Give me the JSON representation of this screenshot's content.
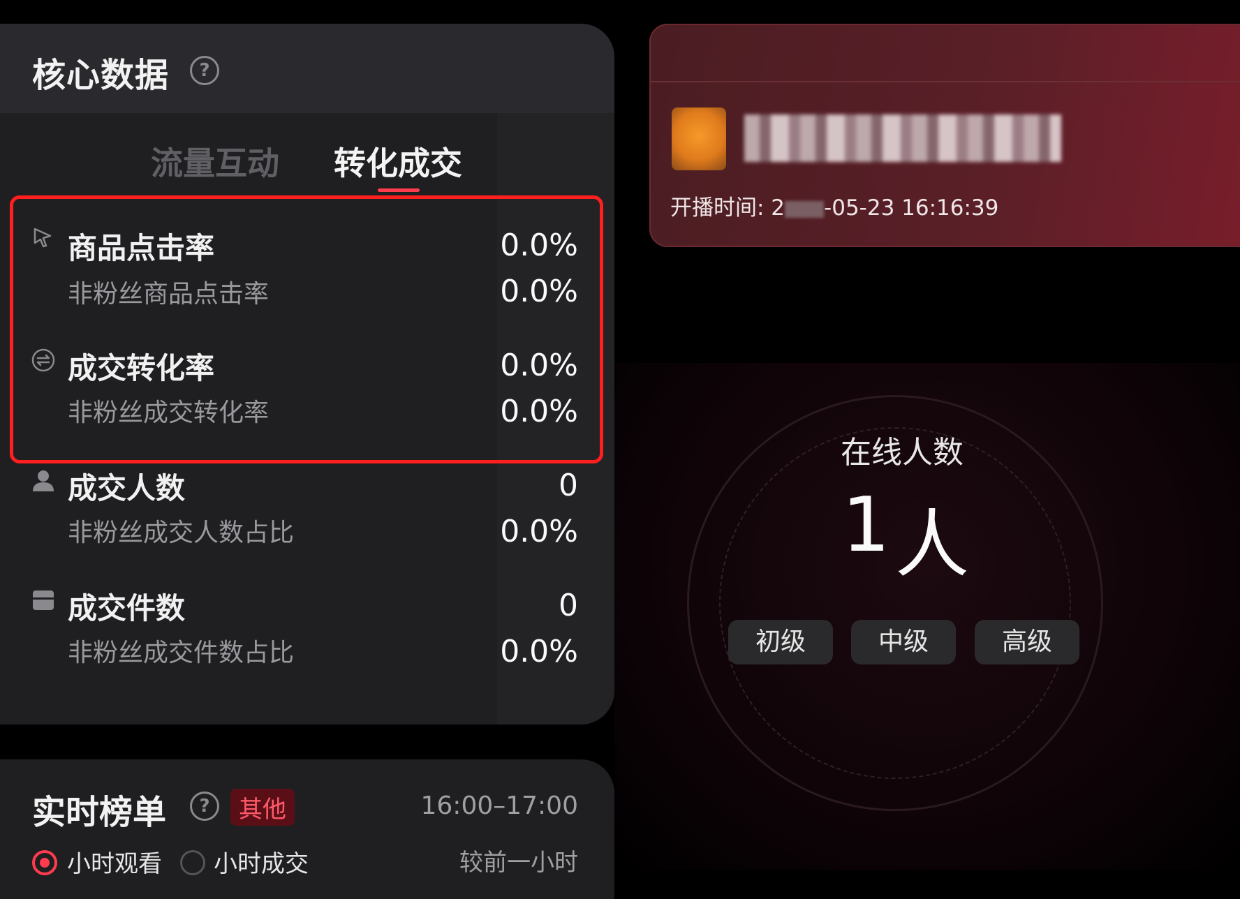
{
  "core": {
    "title": "核心数据",
    "help": "?",
    "tabs": [
      "流量互动",
      "转化成交"
    ],
    "metrics": [
      {
        "name": "商品点击率",
        "value": "0.0%",
        "sub": "非粉丝商品点击率",
        "sub_value": "0.0%",
        "icon": "cursor-click-icon"
      },
      {
        "name": "成交转化率",
        "value": "0.0%",
        "sub": "非粉丝成交转化率",
        "sub_value": "0.0%",
        "icon": "exchange-icon"
      },
      {
        "name": "成交人数",
        "value": "0",
        "sub": "非粉丝成交人数占比",
        "sub_value": "0.0%",
        "icon": "user-icon"
      },
      {
        "name": "成交件数",
        "value": "0",
        "sub": "非粉丝成交件数占比",
        "sub_value": "0.0%",
        "icon": "package-icon"
      }
    ]
  },
  "ranking": {
    "title": "实时榜单",
    "help": "?",
    "badge": "其他",
    "time_range": "16:00–17:00",
    "options": [
      "小时观看",
      "小时成交"
    ],
    "compare": "较前一小时"
  },
  "live": {
    "start_label": "开播时间: 2",
    "start_tail": "-05-23 16:16:39"
  },
  "online": {
    "label": "在线人数",
    "count": "1",
    "unit": "人",
    "levels": [
      "初级",
      "中级",
      "高级"
    ]
  },
  "colors": {
    "accent": "#ff3b4e",
    "highlight_border": "#ff1f1f"
  }
}
